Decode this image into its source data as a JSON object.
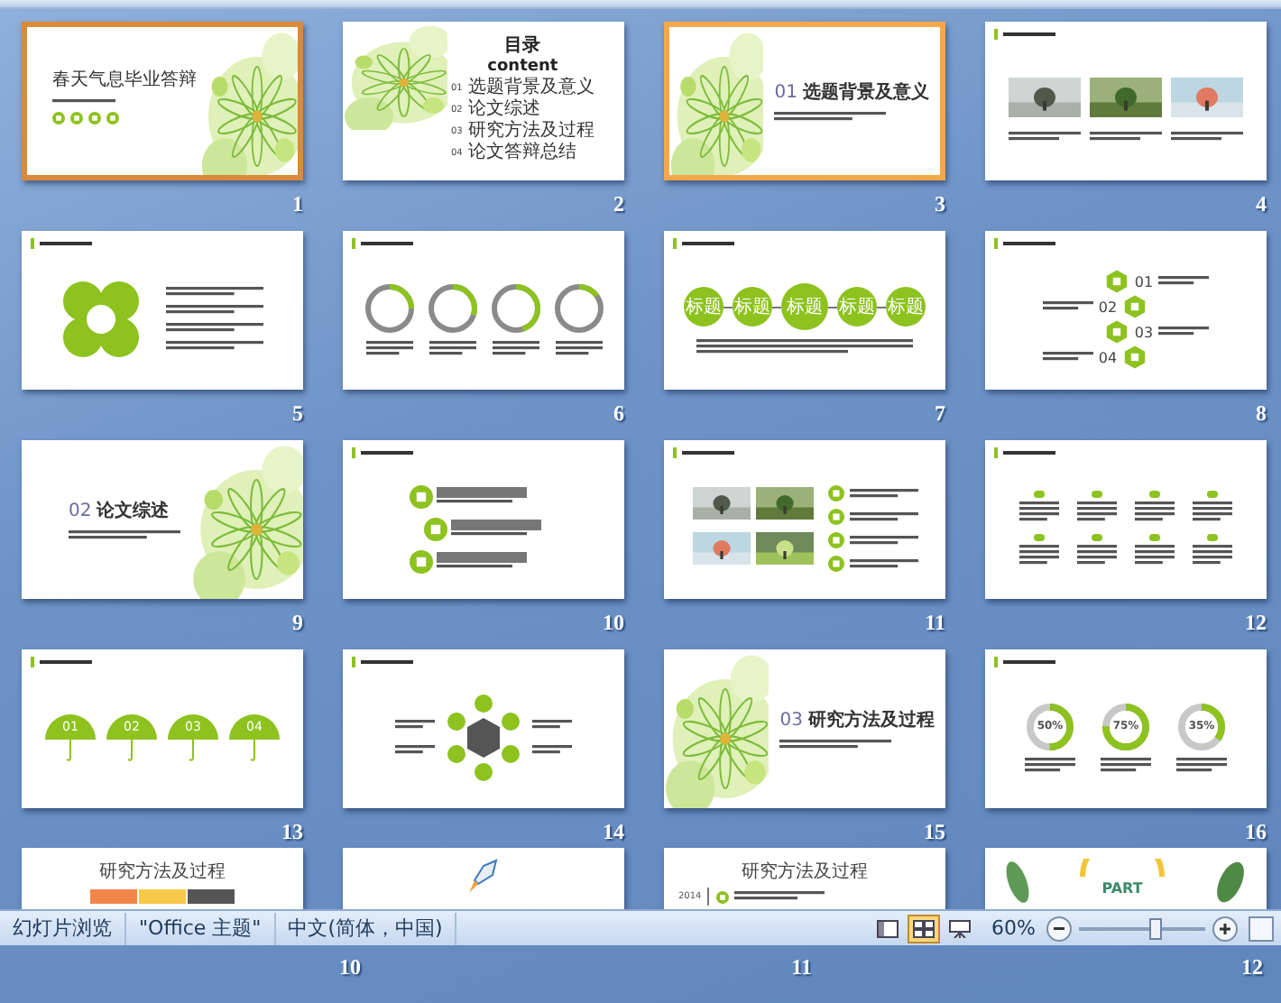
{
  "slides": [
    {
      "number": "1",
      "selected": true,
      "kind": "cover",
      "title": "春天气息毕业答辩"
    },
    {
      "number": "2",
      "selected": false,
      "kind": "toc",
      "title": "目录",
      "subtitle": "content",
      "items": [
        {
          "no": "01",
          "text": "选题背景及意义"
        },
        {
          "no": "02",
          "text": "论文综述"
        },
        {
          "no": "03",
          "text": "研究方法及过程"
        },
        {
          "no": "04",
          "text": "论文答辩总结"
        }
      ]
    },
    {
      "number": "3",
      "selected": true,
      "kind": "section",
      "no": "01",
      "title": "选题背景及意义"
    },
    {
      "number": "4",
      "selected": false,
      "kind": "photos"
    },
    {
      "number": "5",
      "selected": false,
      "kind": "petals"
    },
    {
      "number": "6",
      "selected": false,
      "kind": "rings"
    },
    {
      "number": "7",
      "selected": false,
      "kind": "timeline",
      "labels": [
        "标题",
        "标题",
        "标题",
        "标题",
        "标题"
      ]
    },
    {
      "number": "8",
      "selected": false,
      "kind": "hexes",
      "labels": [
        "01",
        "02",
        "03",
        "04"
      ]
    },
    {
      "number": "9",
      "selected": false,
      "kind": "chapter",
      "no": "02",
      "title": "论文综述"
    },
    {
      "number": "10",
      "selected": false,
      "kind": "bars"
    },
    {
      "number": "11",
      "selected": false,
      "kind": "photogrid"
    },
    {
      "number": "12",
      "selected": false,
      "kind": "icons"
    },
    {
      "number": "13",
      "selected": false,
      "kind": "umbrellas",
      "labels": [
        "01",
        "02",
        "03",
        "04"
      ]
    },
    {
      "number": "14",
      "selected": false,
      "kind": "hexcycle"
    },
    {
      "number": "15",
      "selected": false,
      "kind": "section",
      "no": "03",
      "title": "研究方法及过程"
    },
    {
      "number": "16",
      "selected": false,
      "kind": "donuts",
      "donuts": [
        {
          "label": "50%",
          "level": 0.5
        },
        {
          "label": "75%",
          "level": 0.75
        },
        {
          "label": "35%",
          "level": 0.35
        }
      ]
    }
  ],
  "partial_slides": [
    {
      "kind": "blocks",
      "title": "研究方法及过程"
    },
    {
      "kind": "rocket"
    },
    {
      "kind": "axis",
      "title": "研究方法及过程",
      "year": "2014"
    },
    {
      "kind": "part",
      "label": "PART"
    }
  ],
  "status_bar": {
    "segments": [
      "幻灯片浏览",
      "\"Office 主题\"",
      "中文(简体，中国)"
    ],
    "views": [
      {
        "kind": "normal",
        "selected": false
      },
      {
        "kind": "sorter",
        "selected": true
      },
      {
        "kind": "show",
        "selected": false
      }
    ],
    "zoom": {
      "reading": "60%",
      "level": 0.6
    }
  },
  "lower_numbers": [
    "10",
    "11",
    "12"
  ]
}
